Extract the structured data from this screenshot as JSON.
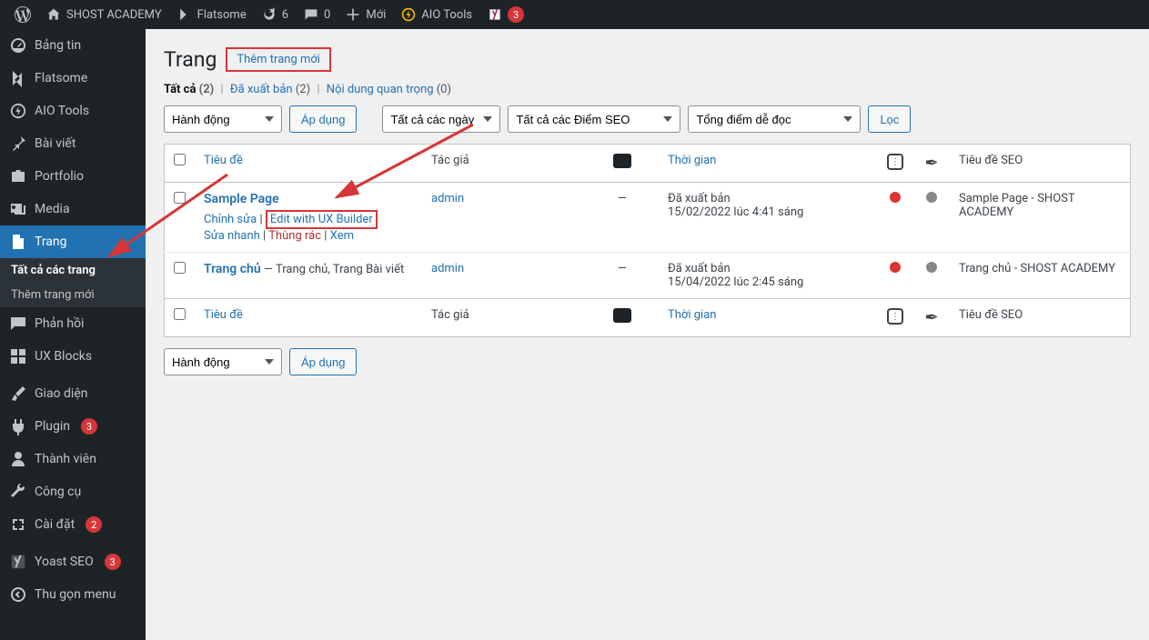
{
  "toolbar": {
    "site_name": "SHOST ACADEMY",
    "flatsome": "Flatsome",
    "updates_count": "6",
    "comments_count": "0",
    "new_label": "Mới",
    "aio_tools": "AIO Tools",
    "yoast_badge": "3"
  },
  "sidebar": {
    "dashboard": "Bảng tin",
    "flatsome": "Flatsome",
    "aio_tools": "AIO Tools",
    "posts": "Bài viết",
    "portfolio": "Portfolio",
    "media": "Media",
    "pages": "Trang",
    "sub_all_pages": "Tất cả các trang",
    "sub_add_new": "Thêm trang mới",
    "comments": "Phản hồi",
    "ux_blocks": "UX Blocks",
    "appearance": "Giao diện",
    "plugins": "Plugin",
    "plugins_badge": "3",
    "users": "Thành viên",
    "tools": "Công cụ",
    "settings": "Cài đặt",
    "settings_badge": "2",
    "yoast": "Yoast SEO",
    "yoast_badge": "3",
    "collapse": "Thu gọn menu"
  },
  "header": {
    "title": "Trang",
    "add_new": "Thêm trang mới"
  },
  "subsubsub": {
    "all_label": "Tất cả",
    "all_count": "(2)",
    "published_label": "Đã xuất bản",
    "published_count": "(2)",
    "cornerstone_label": "Nội dung quan trọng",
    "cornerstone_count": "(0)"
  },
  "filters": {
    "bulk_action": "Hành động",
    "apply": "Áp dụng",
    "all_dates": "Tất cả các ngày",
    "seo_scores": "Tất cả các Điểm SEO",
    "readability": "Tổng điểm dễ đọc",
    "filter": "Lọc"
  },
  "columns": {
    "title": "Tiêu đề",
    "author": "Tác giả",
    "date": "Thời gian",
    "seo_title": "Tiêu đề SEO"
  },
  "rows": [
    {
      "title": "Sample Page",
      "suffix": "",
      "author": "admin",
      "comments": "—",
      "status": "Đã xuất bản",
      "date": "15/02/2022 lúc 4:41 sáng",
      "seo_title": "Sample Page - SHOST ACADEMY",
      "actions": {
        "edit": "Chỉnh sửa",
        "ux": "Edit with UX Builder",
        "quick": "Sửa nhanh",
        "trash": "Thùng rác",
        "view": "Xem"
      }
    },
    {
      "title": "Trang chủ",
      "suffix": " — Trang chủ, Trang Bài viết",
      "author": "admin",
      "comments": "—",
      "status": "Đã xuất bản",
      "date": "15/04/2022 lúc 2:45 sáng",
      "seo_title": "Trang chủ - SHOST ACADEMY"
    }
  ]
}
